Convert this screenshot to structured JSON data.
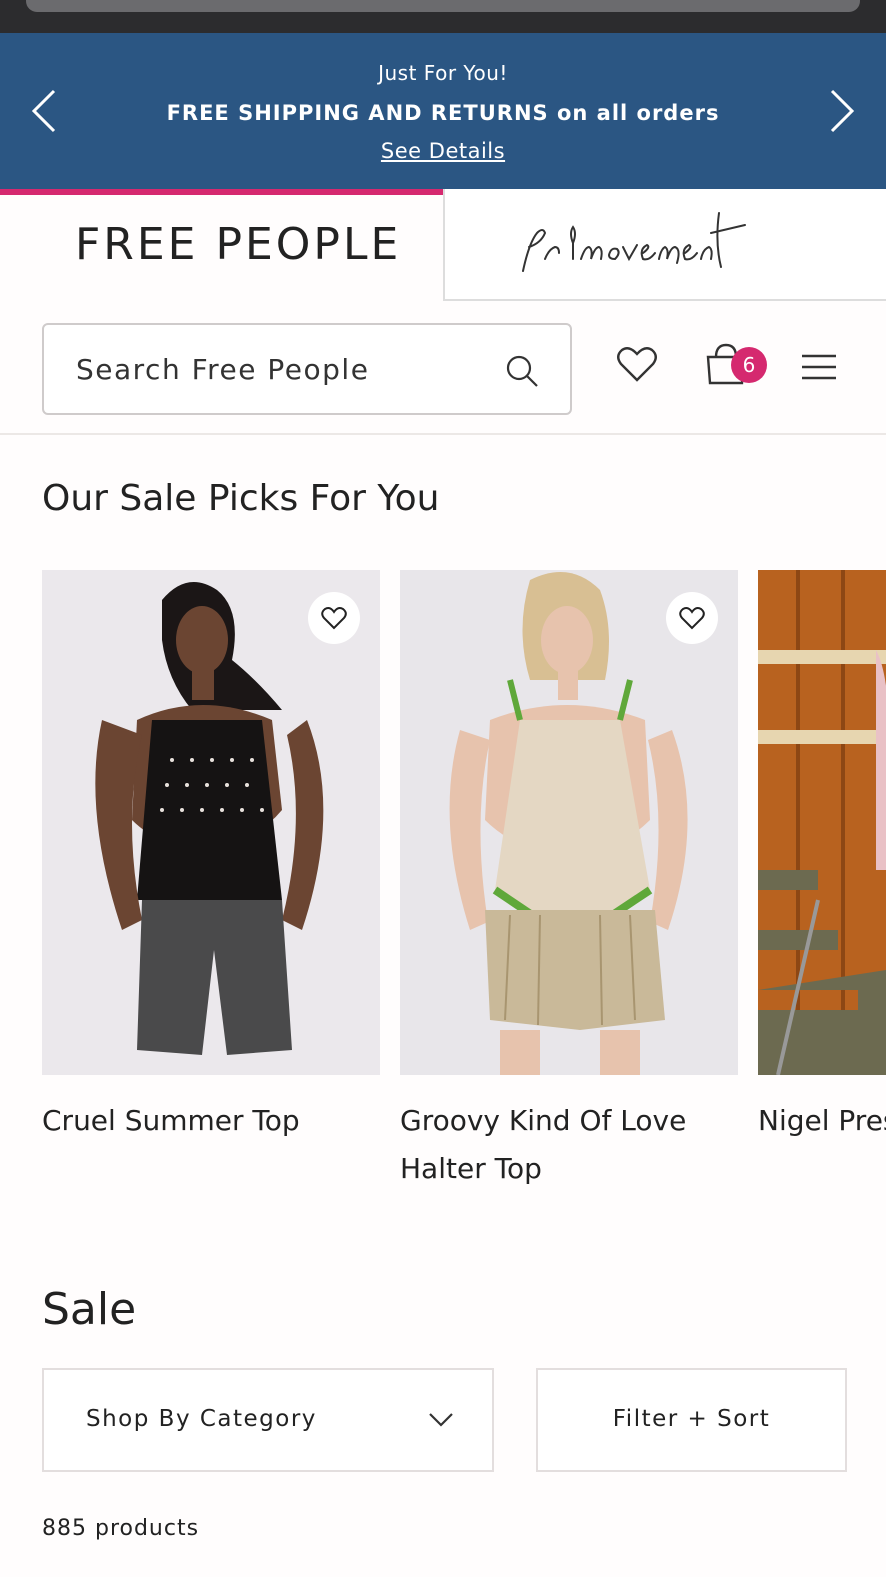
{
  "promo": {
    "line1": "Just For You!",
    "line2": "FREE SHIPPING AND RETURNS on all orders",
    "link": "See Details",
    "bg_color": "#2b5683"
  },
  "brand_tabs": {
    "free_people": "FREE PEOPLE",
    "movement_alt": "fp movement",
    "active_color": "#d5296f"
  },
  "header": {
    "search_placeholder": "Search Free People",
    "cart_count": "6",
    "icons": [
      "search-icon",
      "heart-icon",
      "bag-icon",
      "menu-icon"
    ]
  },
  "sale_picks": {
    "title": "Our Sale Picks For You",
    "products": [
      {
        "name": "Cruel Summer Top"
      },
      {
        "name": "Groovy Kind Of Love Halter Top"
      },
      {
        "name": "Nigel Press Vest"
      }
    ]
  },
  "sale": {
    "title": "Sale",
    "category_label": "Shop By Category",
    "filter_label": "Filter + Sort",
    "count": "885 products"
  }
}
